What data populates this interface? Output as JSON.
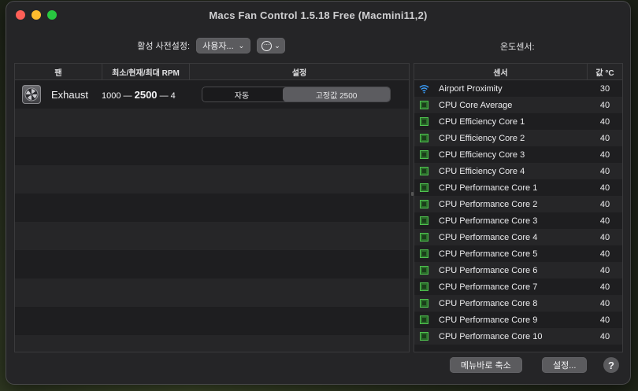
{
  "window": {
    "title": "Macs Fan Control 1.5.18 Free (Macmini11,2)"
  },
  "preset": {
    "label": "활성 사전설정:",
    "value": "사용자...",
    "more_symbol": "⋯"
  },
  "sensors_title": "온도센서:",
  "fan_table": {
    "headers": {
      "fan": "팬",
      "rpm": "최소/현재/최대 RPM",
      "control": "설정"
    },
    "fans": [
      {
        "name": "Exhaust",
        "min_rpm": "1000",
        "current_rpm": "2500",
        "max_rpm": "4",
        "mode_auto": "자동",
        "mode_fixed": "고정값 2500",
        "active_mode": "fixed"
      }
    ]
  },
  "sensor_table": {
    "headers": {
      "name": "센서",
      "value": "값 °C"
    },
    "sensors": [
      {
        "name": "Airport Proximity",
        "value": "30",
        "icon": "wifi-icon"
      },
      {
        "name": "CPU Core Average",
        "value": "40",
        "icon": "chip-icon"
      },
      {
        "name": "CPU Efficiency Core 1",
        "value": "40",
        "icon": "chip-icon"
      },
      {
        "name": "CPU Efficiency Core 2",
        "value": "40",
        "icon": "chip-icon"
      },
      {
        "name": "CPU Efficiency Core 3",
        "value": "40",
        "icon": "chip-icon"
      },
      {
        "name": "CPU Efficiency Core 4",
        "value": "40",
        "icon": "chip-icon"
      },
      {
        "name": "CPU Performance Core 1",
        "value": "40",
        "icon": "chip-icon"
      },
      {
        "name": "CPU Performance Core 2",
        "value": "40",
        "icon": "chip-icon"
      },
      {
        "name": "CPU Performance Core 3",
        "value": "40",
        "icon": "chip-icon"
      },
      {
        "name": "CPU Performance Core 4",
        "value": "40",
        "icon": "chip-icon"
      },
      {
        "name": "CPU Performance Core 5",
        "value": "40",
        "icon": "chip-icon"
      },
      {
        "name": "CPU Performance Core 6",
        "value": "40",
        "icon": "chip-icon"
      },
      {
        "name": "CPU Performance Core 7",
        "value": "40",
        "icon": "chip-icon"
      },
      {
        "name": "CPU Performance Core 8",
        "value": "40",
        "icon": "chip-icon"
      },
      {
        "name": "CPU Performance Core 9",
        "value": "40",
        "icon": "chip-icon"
      },
      {
        "name": "CPU Performance Core 10",
        "value": "40",
        "icon": "chip-icon"
      }
    ]
  },
  "bottom": {
    "minimize_label": "메뉴바로 축소",
    "settings_label": "설정...",
    "help_label": "?"
  },
  "colors": {
    "wifi": "#3aa0ff",
    "chip_green": "#4fc24f"
  }
}
